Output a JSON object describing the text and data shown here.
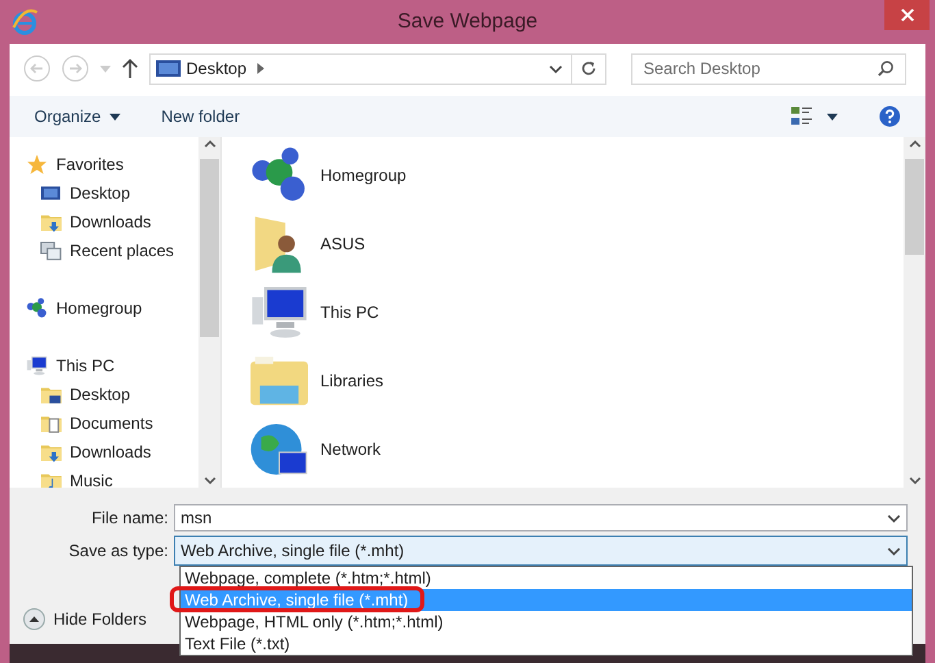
{
  "window": {
    "title": "Save Webpage"
  },
  "address_bar": {
    "location": "Desktop"
  },
  "search": {
    "placeholder": "Search Desktop"
  },
  "toolbar": {
    "organize": "Organize",
    "new_folder": "New folder"
  },
  "navigation": [
    {
      "label": "Favorites",
      "kind": "star",
      "children": [
        {
          "label": "Desktop",
          "kind": "monitor"
        },
        {
          "label": "Downloads",
          "kind": "download-folder"
        },
        {
          "label": "Recent places",
          "kind": "recent"
        }
      ]
    },
    {
      "label": "Homegroup",
      "kind": "spheres"
    },
    {
      "label": "This PC",
      "kind": "computer",
      "children": [
        {
          "label": "Desktop",
          "kind": "desktop-folder"
        },
        {
          "label": "Documents",
          "kind": "documents-folder"
        },
        {
          "label": "Downloads",
          "kind": "download-folder"
        },
        {
          "label": "Music",
          "kind": "music-folder"
        }
      ]
    }
  ],
  "items": [
    {
      "label": "Homegroup",
      "kind": "spheres"
    },
    {
      "label": "ASUS",
      "kind": "user-folder"
    },
    {
      "label": "This PC",
      "kind": "computer"
    },
    {
      "label": "Libraries",
      "kind": "libraries"
    },
    {
      "label": "Network",
      "kind": "globe"
    }
  ],
  "file_name": {
    "label": "File name:",
    "value": "msn"
  },
  "save_as_type": {
    "label": "Save as type:",
    "value": "Web Archive, single file (*.mht)",
    "options": [
      {
        "label": "Webpage, complete (*.htm;*.html)",
        "selected": false
      },
      {
        "label": "Web Archive, single file (*.mht)",
        "selected": true
      },
      {
        "label": "Webpage, HTML only (*.htm;*.html)",
        "selected": false
      },
      {
        "label": "Text File (*.txt)",
        "selected": false
      }
    ]
  },
  "hide_folders": "Hide Folders"
}
